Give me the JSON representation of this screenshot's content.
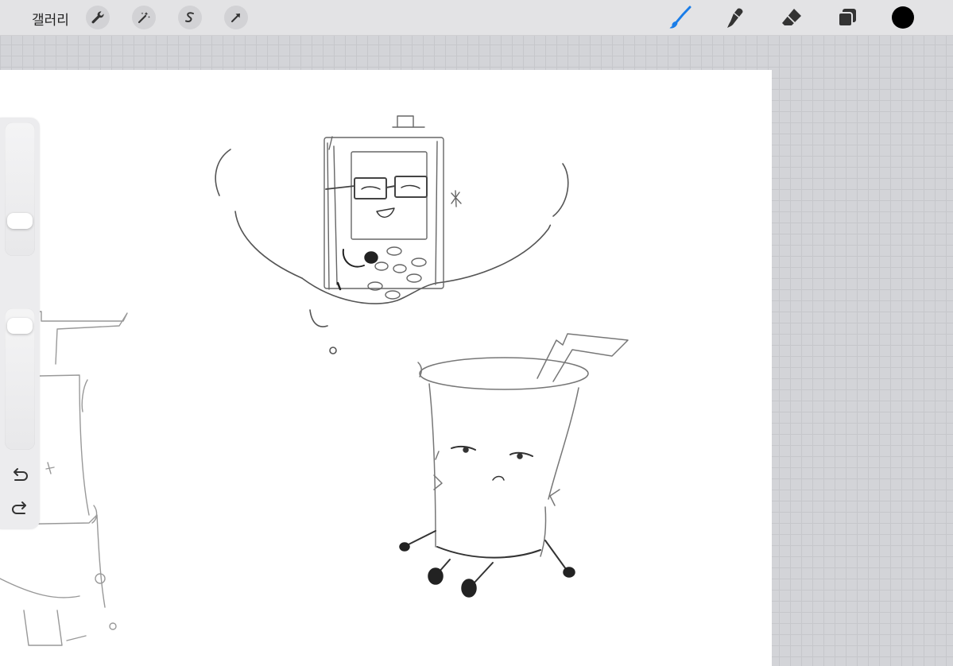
{
  "topbar": {
    "gallery_label": "갤러리",
    "left_tools": [
      {
        "icon": "wrench-icon",
        "name": "actions-button"
      },
      {
        "icon": "magic-wand-icon",
        "name": "adjustments-button"
      },
      {
        "icon": "selection-s-icon",
        "name": "selection-button"
      },
      {
        "icon": "arrow-cursor-icon",
        "name": "transform-button"
      }
    ],
    "right_tools": [
      {
        "icon": "brush-icon",
        "name": "brush-tool",
        "active": true
      },
      {
        "icon": "smudge-icon",
        "name": "smudge-tool"
      },
      {
        "icon": "eraser-icon",
        "name": "eraser-tool"
      },
      {
        "icon": "layers-icon",
        "name": "layers-button"
      }
    ],
    "current_color": "#000000",
    "active_color": "#1a7de8"
  },
  "sidebar": {
    "size_slider_icon": "brush-size-slider",
    "opacity_slider_icon": "opacity-slider",
    "modify_icon": "square-icon",
    "undo_icon": "undo-icon",
    "redo_icon": "redo-icon"
  }
}
